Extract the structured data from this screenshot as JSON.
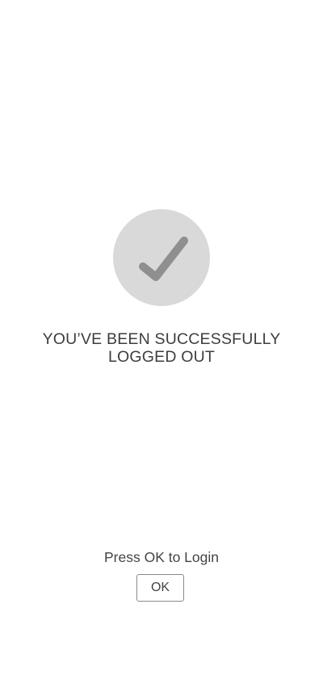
{
  "logout": {
    "icon": "checkmark-icon",
    "message_line1": "YOU’VE BEEN SUCCESSFULLY",
    "message_line2": "LOGGED OUT",
    "prompt": "Press OK to Login",
    "ok_label": "OK"
  },
  "colors": {
    "background": "#ffffff",
    "circle": "#d9d9d9",
    "checkmark": "#8f8f8f",
    "text": "#3d3d3d",
    "button_border": "#8a8a8a"
  }
}
